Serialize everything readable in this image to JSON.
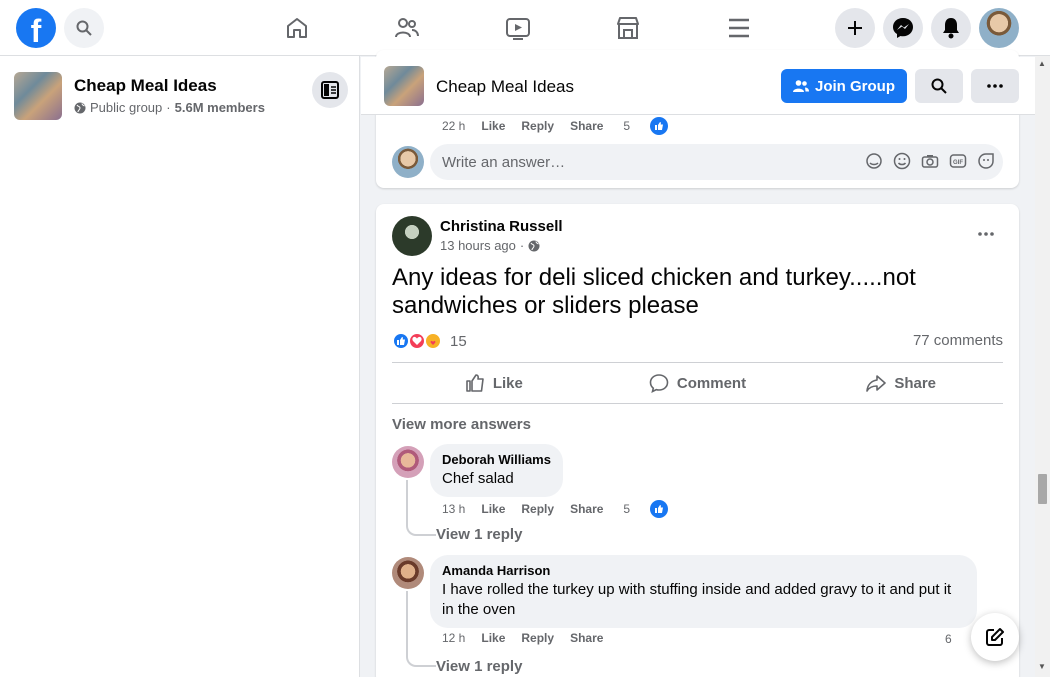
{
  "topbar": {
    "logo": "f",
    "icons": [
      "search-icon",
      "home-icon",
      "friends-icon",
      "watch-icon",
      "marketplace-icon",
      "menu-icon",
      "create-icon",
      "messenger-icon",
      "notifications-icon",
      "profile-avatar"
    ]
  },
  "group": {
    "name": "Cheap Meal Ideas",
    "privacy": "Public group",
    "separator": "·",
    "members": "5.6M members",
    "join_label": "Join Group"
  },
  "prev_comment": {
    "time": "22 h",
    "like": "Like",
    "reply": "Reply",
    "share": "Share",
    "likes": "5"
  },
  "answer_input": {
    "placeholder": "Write an answer…"
  },
  "post": {
    "author": "Christina Russell",
    "time": "13 hours ago",
    "separator": "·",
    "text": "Any ideas for deli sliced chicken and turkey.....not sandwiches or sliders please",
    "reaction_count": "15",
    "comments": "77 comments",
    "actions": {
      "like": "Like",
      "comment": "Comment",
      "share": "Share"
    },
    "view_more": "View more answers"
  },
  "comments": [
    {
      "name": "Deborah Williams",
      "text": "Chef salad",
      "time": "13 h",
      "like": "Like",
      "reply": "Reply",
      "share": "Share",
      "likes": "5",
      "view_reply": "View 1 reply"
    },
    {
      "name": "Amanda Harrison",
      "text": "I have rolled the turkey up with stuffing inside and added gravy to it and put it in the oven",
      "time": "12 h",
      "like": "Like",
      "reply": "Reply",
      "share": "Share",
      "likes": "6",
      "view_reply": "View 1 reply"
    }
  ],
  "colors": {
    "brand": "#1877f2",
    "secondary_text": "#65676b",
    "love": "#f33e58",
    "care": "#f7b125"
  }
}
